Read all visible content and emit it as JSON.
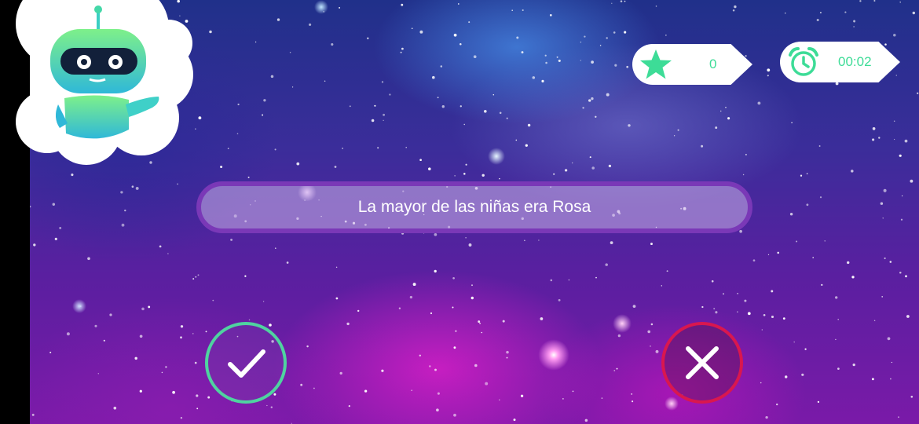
{
  "hud": {
    "score_icon": "star-icon",
    "score_value": "0",
    "timer_icon": "alarm-clock-icon",
    "timer_value": "00:02"
  },
  "question": {
    "text": "La mayor de las niñas era Rosa"
  },
  "answers": {
    "true_icon": "check-icon",
    "false_icon": "close-icon"
  },
  "mascot": {
    "icon": "robot-mascot-icon"
  },
  "colors": {
    "accent_green": "#3ddc97",
    "true_border": "#4fd3a0",
    "false_border": "#d9174f",
    "statement_border": "#7a38b7"
  }
}
